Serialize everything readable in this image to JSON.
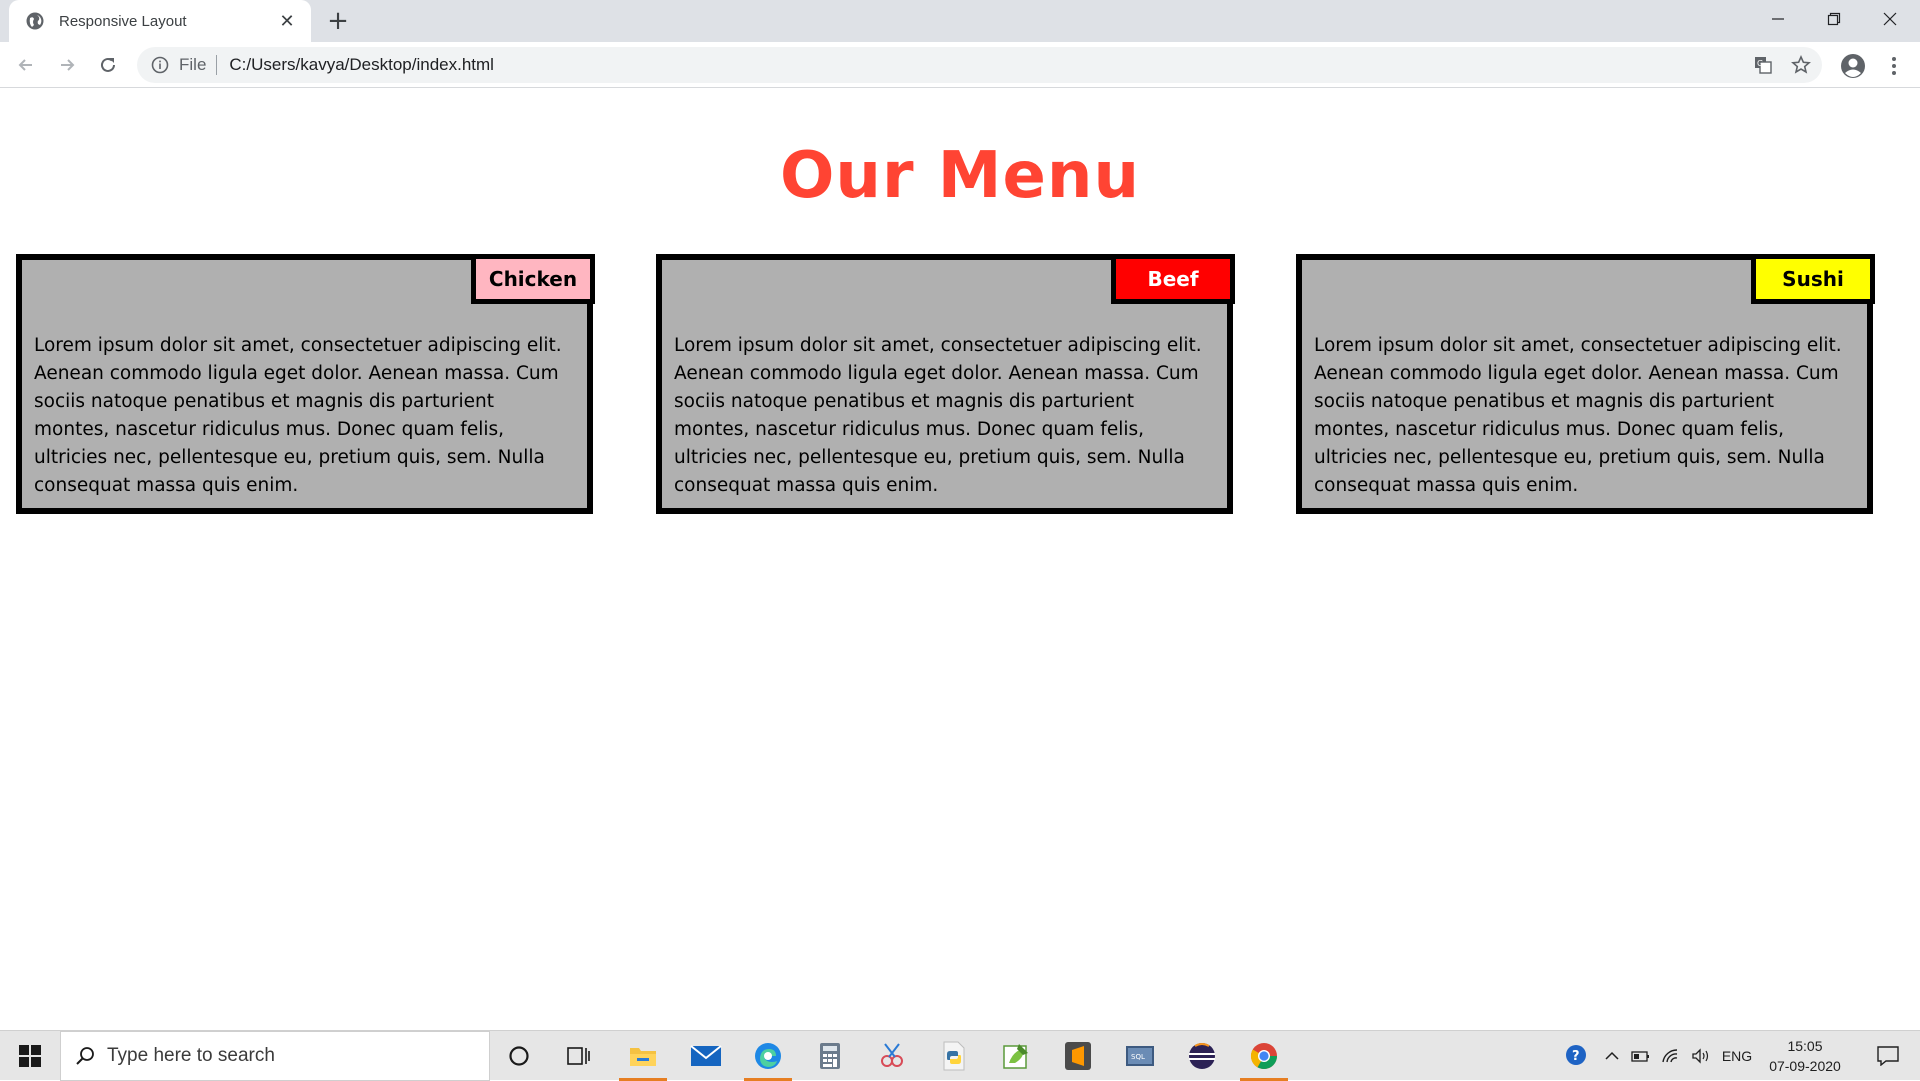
{
  "browser": {
    "tab_title": "Responsive Layout",
    "new_tab_symbol": "+",
    "scheme_label": "File",
    "url": "C:/Users/kavya/Desktop/index.html"
  },
  "page": {
    "title": "Our Menu",
    "cards": [
      {
        "badge": "Chicken",
        "badge_color": "#ffb6c1",
        "text": "Lorem ipsum dolor sit amet, consectetuer adipiscing elit. Aenean commodo ligula eget dolor. Aenean massa. Cum sociis natoque penatibus et magnis dis parturient montes, nascetur ridiculus mus. Donec quam felis, ultricies nec, pellentesque eu, pretium quis, sem. Nulla consequat massa quis enim."
      },
      {
        "badge": "Beef",
        "badge_color": "#ff0000",
        "text": "Lorem ipsum dolor sit amet, consectetuer adipiscing elit. Aenean commodo ligula eget dolor. Aenean massa. Cum sociis natoque penatibus et magnis dis parturient montes, nascetur ridiculus mus. Donec quam felis, ultricies nec, pellentesque eu, pretium quis, sem. Nulla consequat massa quis enim."
      },
      {
        "badge": "Sushi",
        "badge_color": "#ffff00",
        "text": "Lorem ipsum dolor sit amet, consectetuer adipiscing elit. Aenean commodo ligula eget dolor. Aenean massa. Cum sociis natoque penatibus et magnis dis parturient montes, nascetur ridiculus mus. Donec quam felis, ultricies nec, pellentesque eu, pretium quis, sem. Nulla consequat massa quis enim."
      }
    ],
    "colors": {
      "title": "#ff4433",
      "card_background": "#b0b0b0",
      "card_border": "#000000"
    }
  },
  "taskbar": {
    "search_placeholder": "Type here to search",
    "pinned_apps": [
      "cortana-icon",
      "task-view-icon",
      "file-explorer-icon",
      "mail-icon",
      "edge-icon",
      "calculator-icon",
      "snip-sketch-icon",
      "python-icon",
      "notepad-plus-plus-icon",
      "sublime-text-icon",
      "sql-developer-icon",
      "eclipse-icon",
      "chrome-icon"
    ],
    "language": "ENG",
    "time": "15:05",
    "date": "07-09-2020"
  }
}
